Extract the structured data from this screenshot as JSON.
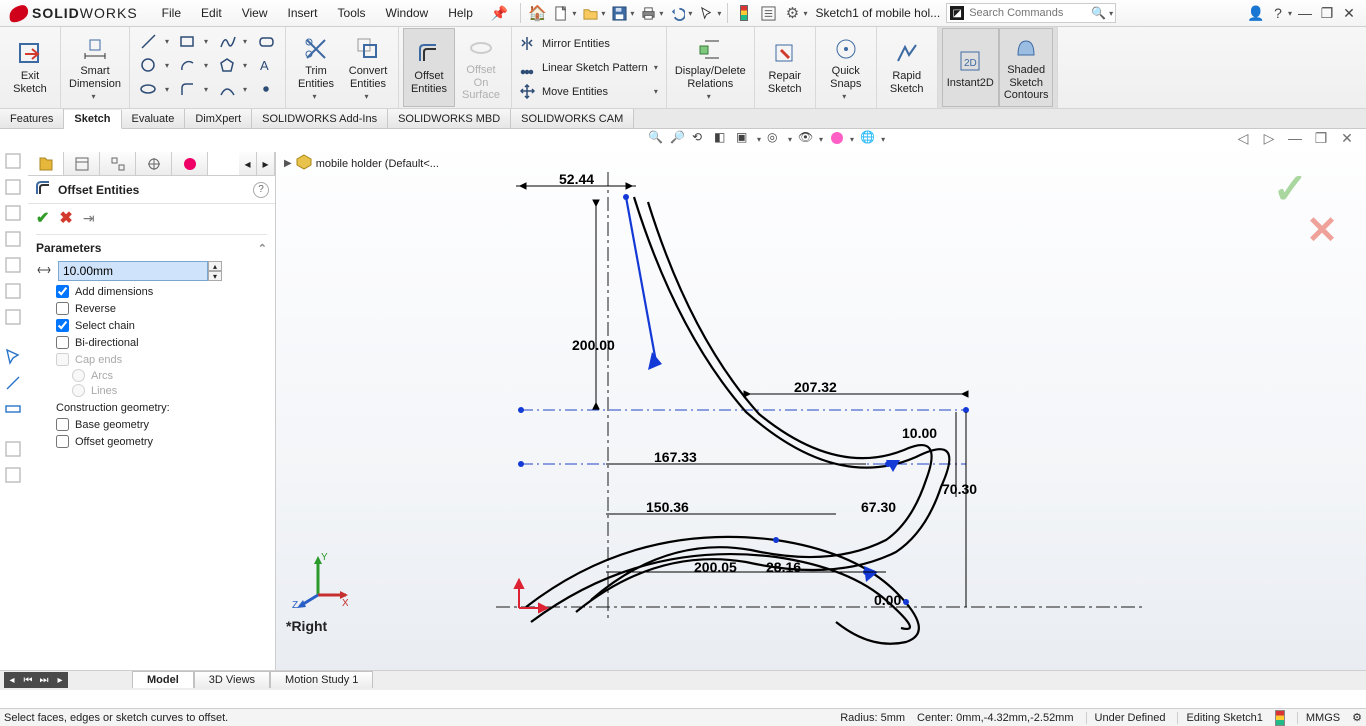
{
  "app": {
    "name_solid": "SOLID",
    "name_works": "WORKS"
  },
  "menu": {
    "file": "File",
    "edit": "Edit",
    "view": "View",
    "insert": "Insert",
    "tools": "Tools",
    "window": "Window",
    "help": "Help"
  },
  "titlebar": {
    "doc": "Sketch1 of mobile hol...",
    "search_placeholder": "Search Commands"
  },
  "ribbon": {
    "exit_sketch": "Exit\nSketch",
    "smart_dim": "Smart\nDimension",
    "trim": "Trim\nEntities",
    "convert": "Convert\nEntities",
    "offset": "Offset\nEntities",
    "offset_surface": "Offset\nOn\nSurface",
    "mirror": "Mirror Entities",
    "linear_pattern": "Linear Sketch Pattern",
    "move": "Move Entities",
    "disp_del": "Display/Delete\nRelations",
    "repair": "Repair\nSketch",
    "quick_snaps": "Quick\nSnaps",
    "rapid": "Rapid\nSketch",
    "instant": "Instant2D",
    "shaded": "Shaded\nSketch\nContours"
  },
  "cmtabs": {
    "features": "Features",
    "sketch": "Sketch",
    "evaluate": "Evaluate",
    "dimxpert": "DimXpert",
    "addins": "SOLIDWORKS Add-Ins",
    "mbd": "SOLIDWORKS MBD",
    "cam": "SOLIDWORKS CAM"
  },
  "flyout": {
    "part": "mobile holder  (Default<..."
  },
  "propmgr": {
    "title": "Offset Entities",
    "section": "Parameters",
    "distance": "10.00mm",
    "add_dim": "Add dimensions",
    "reverse": "Reverse",
    "select_chain": "Select chain",
    "bidir": "Bi-directional",
    "cap": "Cap ends",
    "arcs": "Arcs",
    "lines": "Lines",
    "constr": "Construction geometry:",
    "base": "Base geometry",
    "off": "Offset geometry"
  },
  "dimensions": {
    "d1": "52.44",
    "d2": "200.00",
    "d3": "207.32",
    "d4": "10.00",
    "d5": "167.33",
    "d6": "70.30",
    "d7": "150.36",
    "d8": "67.30",
    "d9": "200.05",
    "d10": "28.16",
    "d11": "0.00"
  },
  "plane": "*Right",
  "bottom_tabs": {
    "model": "Model",
    "views3d": "3D Views",
    "motion": "Motion Study 1"
  },
  "status": {
    "msg": "Select faces, edges or sketch curves to offset.",
    "radius": "Radius: 5mm",
    "center": "Center: 0mm,-4.32mm,-2.52mm",
    "under": "Under Defined",
    "editing": "Editing Sketch1",
    "units": "MMGS"
  }
}
